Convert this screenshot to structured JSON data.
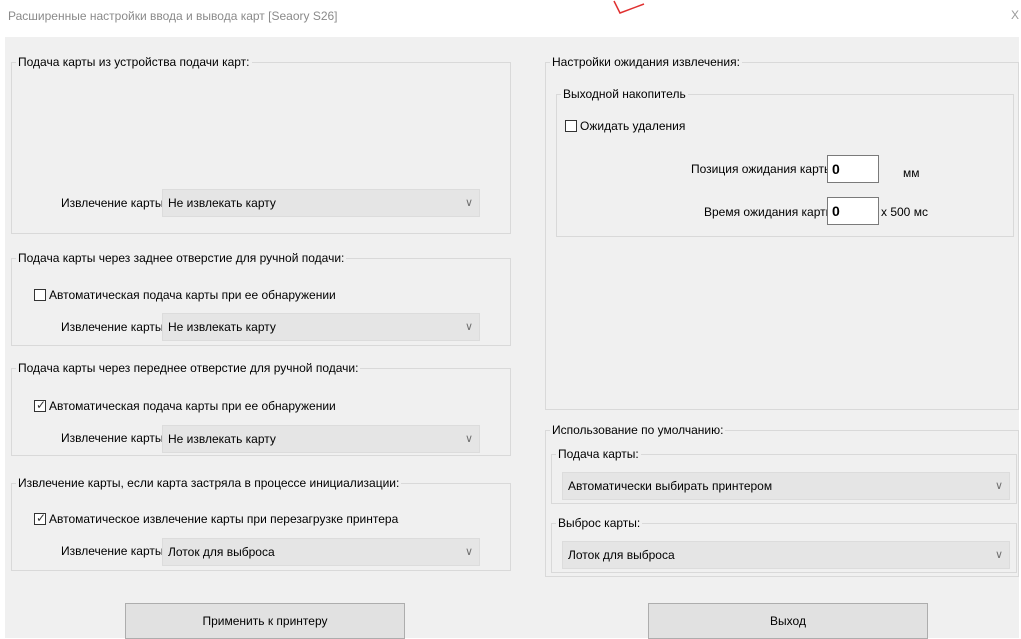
{
  "window": {
    "title": "Расширенные настройки ввода и вывода карт [Seaory S26]",
    "close_glyph": "X"
  },
  "feeder_group": {
    "legend": "Подача карты из устройства подачи карт:",
    "eject_label": "Извлечение карты:",
    "eject_value": "Не извлекать карту"
  },
  "rear_manual_group": {
    "legend": "Подача карты через заднее отверстие для ручной подачи:",
    "auto_feed_label": "Автоматическая подача карты при ее обнаружении",
    "auto_feed_checked": false,
    "eject_label": "Извлечение карты:",
    "eject_value": "Не извлекать карту"
  },
  "front_manual_group": {
    "legend": "Подача карты через переднее отверстие для ручной подачи:",
    "auto_feed_label": "Автоматическая подача карты при ее обнаружении",
    "auto_feed_checked": true,
    "eject_label": "Извлечение карты:",
    "eject_value": "Не извлекать карту"
  },
  "init_jam_group": {
    "legend": "Извлечение карты, если карта застряла в процессе инициализации:",
    "auto_eject_label": "Автоматическое извлечение карты при перезагрузке принтера",
    "auto_eject_checked": true,
    "eject_label": "Извлечение карты:",
    "eject_value": "Лоток для выброса"
  },
  "wait_settings_group": {
    "legend": "Настройки ожидания извлечения:",
    "output_stacker": {
      "legend": "Выходной накопитель",
      "wait_removal_label": "Ожидать удаления",
      "wait_removal_checked": false,
      "wait_position_label": "Позиция ожидания карты:",
      "wait_position_value": "0",
      "wait_position_unit": "мм",
      "wait_time_label": "Время ожидания карты:",
      "wait_time_value": "0",
      "wait_time_unit": "x 500 мс"
    }
  },
  "defaults_group": {
    "legend": "Использование по умолчанию:",
    "feed": {
      "legend": "Подача карты:",
      "value": "Автоматически выбирать принтером"
    },
    "eject": {
      "legend": "Выброс карты:",
      "value": "Лоток для выброса"
    }
  },
  "buttons": {
    "apply": "Применить к принтеру",
    "exit": "Выход"
  },
  "icons": {
    "dropdown": "chevron-down-icon",
    "checkmark": "checkmark-icon"
  },
  "colors": {
    "dialog_bg": "#f0f0f0",
    "combo_bg": "#e5e5e5",
    "annotation_arrow": "#e03030"
  }
}
